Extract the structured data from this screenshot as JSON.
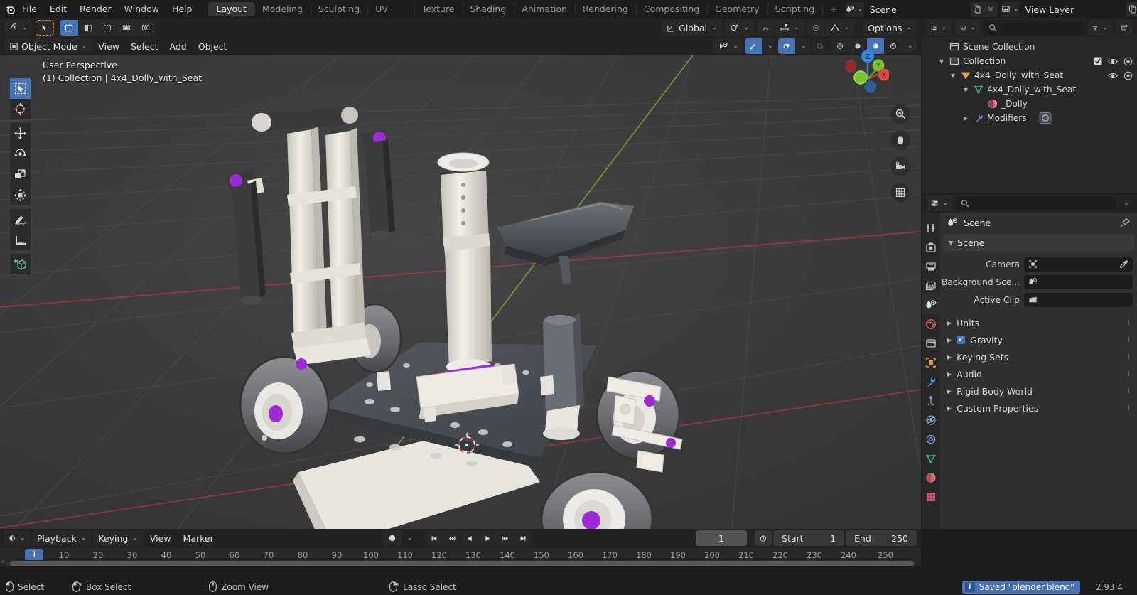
{
  "app": {
    "version": "2.93.4"
  },
  "topbar": {
    "logo_icon": "blender-logo-icon",
    "menus": [
      "File",
      "Edit",
      "Render",
      "Window",
      "Help"
    ],
    "workspace_tabs": [
      {
        "label": "Layout",
        "active": true
      },
      {
        "label": "Modeling",
        "active": false
      },
      {
        "label": "Sculpting",
        "active": false
      },
      {
        "label": "UV Editing",
        "active": false
      },
      {
        "label": "Texture Paint",
        "active": false
      },
      {
        "label": "Shading",
        "active": false
      },
      {
        "label": "Animation",
        "active": false
      },
      {
        "label": "Rendering",
        "active": false
      },
      {
        "label": "Compositing",
        "active": false
      },
      {
        "label": "Geometry Nodes",
        "active": false
      },
      {
        "label": "Scripting",
        "active": false
      }
    ],
    "add_workspace_label": "+",
    "scene": {
      "icon": "scene-icon",
      "name": "Scene",
      "new_label": "",
      "close_label": "✕"
    },
    "view_layer": {
      "icon": "view-layer-icon",
      "name": "View Layer",
      "close_label": "✕"
    }
  },
  "viewport": {
    "header": {
      "editor_type_icon": "editor-type-icon",
      "mode": "Object Mode",
      "menus": [
        "View",
        "Select",
        "Add",
        "Object"
      ],
      "transform_orientation": "Global",
      "options_label": "Options",
      "snap_icon": "magnet-icon",
      "proportional_icon": "proportional-edit-icon"
    },
    "overlay_text": {
      "line1": "User Perspective",
      "line2": "(1) Collection | 4x4_Dolly_with_Seat"
    },
    "tools": [
      {
        "name": "tweak-select-tool",
        "active": true
      },
      {
        "name": "cursor-tool",
        "active": false
      },
      {
        "name": "move-tool",
        "active": false
      },
      {
        "name": "rotate-tool",
        "active": false
      },
      {
        "name": "scale-tool",
        "active": false
      },
      {
        "name": "transform-tool",
        "active": false
      },
      {
        "name": "annotate-tool",
        "active": false
      },
      {
        "name": "measure-tool",
        "active": false
      },
      {
        "name": "add-cube-tool",
        "active": false
      }
    ],
    "gizmo_axes": [
      "Z",
      "Y",
      "X"
    ],
    "nav_buttons": [
      "zoom-icon",
      "pan-hand-icon",
      "camera-icon",
      "orthographic-grid-icon"
    ]
  },
  "outliner": {
    "header": {
      "display_mode_icon": "outliner-display-mode-icon",
      "filter_id_icon": "id-type-filter-icon",
      "search_placeholder": "",
      "filter_icon": "funnel-icon",
      "new_collection_icon": "new-collection-icon"
    },
    "rows": [
      {
        "label": "Scene Collection",
        "indent": 0,
        "icon": "scene-collection-icon",
        "tri": "",
        "eyes": false,
        "check": false
      },
      {
        "label": "Collection",
        "indent": 1,
        "icon": "collection-icon",
        "tri": "▼",
        "eyes": true,
        "check": true
      },
      {
        "label": "4x4_Dolly_with_Seat",
        "indent": 2,
        "icon": "object-mesh-icon",
        "tri": "▼",
        "eyes": true,
        "check": false
      },
      {
        "label": "4x4_Dolly_with_Seat",
        "indent": 3,
        "icon": "mesh-data-icon",
        "tri": "▼",
        "eyes": false,
        "check": false
      },
      {
        "label": "_Dolly",
        "indent": 4,
        "icon": "material-icon",
        "tri": "",
        "eyes": false,
        "check": false
      },
      {
        "label": "Modifiers",
        "indent": 3,
        "icon": "wrench-icon",
        "tri": "▶",
        "eyes": false,
        "check": false,
        "badge": "modifier-badge-icon"
      }
    ]
  },
  "properties": {
    "header": {
      "editor_type_icon": "properties-editor-icon",
      "search_placeholder": ""
    },
    "tabs": [
      {
        "name": "tool-tab",
        "active": false
      },
      {
        "name": "render-tab",
        "active": false
      },
      {
        "name": "output-tab",
        "active": false
      },
      {
        "name": "view-layer-tab",
        "active": false
      },
      {
        "name": "scene-tab",
        "active": true
      },
      {
        "name": "world-tab",
        "active": false
      },
      {
        "name": "collection-tab",
        "active": false
      },
      {
        "name": "object-tab",
        "active": false
      },
      {
        "name": "modifiers-tab",
        "active": false
      },
      {
        "name": "particles-tab",
        "active": false
      },
      {
        "name": "physics-tab",
        "active": false
      },
      {
        "name": "constraints-tab",
        "active": false
      },
      {
        "name": "object-data-tab",
        "active": false
      },
      {
        "name": "material-tab",
        "active": false
      },
      {
        "name": "texture-tab",
        "active": false
      }
    ],
    "breadcrumb": "Scene",
    "pin_icon": "pin-icon",
    "panel_title": "Scene",
    "fields": [
      {
        "label": "Camera",
        "value": "",
        "icon": "camera-data-icon",
        "eyedropper": true
      },
      {
        "label": "Background Sce...",
        "value": "",
        "icon": "scene-icon",
        "eyedropper": false
      },
      {
        "label": "Active Clip",
        "value": "",
        "icon": "clip-icon",
        "eyedropper": false
      }
    ],
    "collapsed_panels": [
      {
        "label": "Units",
        "checkbox": false
      },
      {
        "label": "Gravity",
        "checkbox": true
      },
      {
        "label": "Keying Sets",
        "checkbox": false
      },
      {
        "label": "Audio",
        "checkbox": false
      },
      {
        "label": "Rigid Body World",
        "checkbox": false
      },
      {
        "label": "Custom Properties",
        "checkbox": false
      }
    ]
  },
  "timeline": {
    "editor_icon": "timeline-editor-icon",
    "menus": [
      "Playback",
      "Keying",
      "View",
      "Marker"
    ],
    "record_icon": "auto-keying-icon",
    "transport": [
      "jump-start-icon",
      "prev-keyframe-icon",
      "play-reverse-icon",
      "play-icon",
      "next-keyframe-icon",
      "jump-end-icon"
    ],
    "current_frame": "1",
    "use_preview_icon": "stopwatch-icon",
    "start_label": "Start",
    "start_value": "1",
    "end_label": "End",
    "end_value": "250",
    "frame_ticks": [
      "10",
      "20",
      "30",
      "40",
      "50",
      "60",
      "70",
      "80",
      "90",
      "100",
      "110",
      "120",
      "130",
      "140",
      "150",
      "160",
      "170",
      "180",
      "190",
      "200",
      "210",
      "220",
      "230",
      "240",
      "250"
    ],
    "playhead_label": "1"
  },
  "status": {
    "hints": [
      {
        "icon": "mouse-left-icon",
        "label": "Select"
      },
      {
        "icon": "mouse-left-drag-icon",
        "label": "Box Select"
      },
      {
        "icon": "mouse-middle-icon",
        "label": "Zoom View"
      },
      {
        "icon": "mouse-right-icon",
        "label": "Lasso Select"
      }
    ],
    "message": "Saved \"blender.blend\"",
    "message_badge": "i",
    "version": "2.93.4"
  },
  "colors": {
    "accent": "#4772b3",
    "viewport_bg": "#3b3b3b",
    "panel_bg": "#303030",
    "header_bg": "#232323",
    "outliner_bg": "#282828",
    "grid_x_axis": "#a33b3b",
    "grid_y_axis": "#7faa3b"
  }
}
